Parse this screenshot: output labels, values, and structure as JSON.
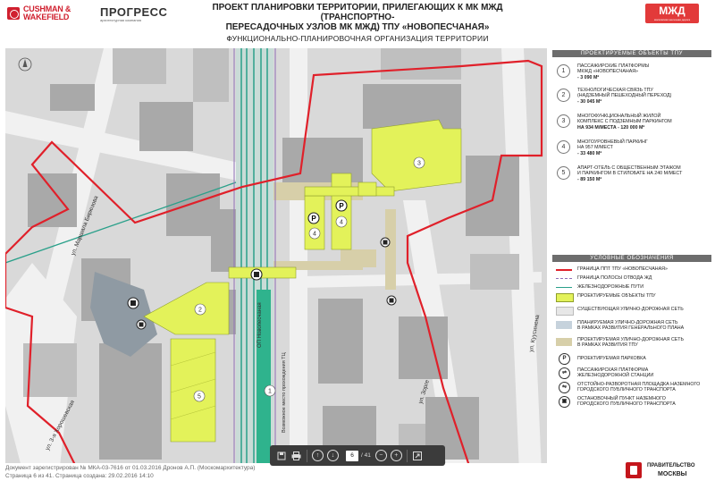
{
  "header": {
    "cw_brand_line1": "CUSHMAN &",
    "cw_brand_line2": "WAKEFIELD",
    "pr_brand": "ПРОГРЕСС",
    "pr_sub": "архитектурная компания",
    "title_line1": "ПРОЕКТ ПЛАНИРОВКИ ТЕРРИТОРИИ, ПРИЛЕГАЮЩИХ К МК МЖД  (ТРАНСПОРТНО-",
    "title_line2": "ПЕРЕСАДОЧНЫХ УЗЛОВ МК МЖД) ТПУ «НОВОПЕСЧАНАЯ»",
    "subtitle": "ФУНКЦИОНАЛЬНО-ПЛАНИРОВОЧНАЯ ОРГАНИЗАЦИЯ ТЕРРИТОРИИ",
    "mzd_brand": "МЖД",
    "mzd_sub": "московская железная дорога"
  },
  "map": {
    "street_labels": [
      "ул. Маршала Бирюзова",
      "ОП Новопесчаная",
      "Возможное место прохождения ТЦ",
      "ул. Зорге",
      "ул. Куусинена",
      "ул. 3-я Хорошевская"
    ],
    "object_markers": [
      "1",
      "2",
      "3",
      "4",
      "4",
      "5"
    ],
    "parking_symbol": "P"
  },
  "panel": {
    "objects_header": "ПРОЕКТИРУЕМЫЕ ОБЪЕКТЫ ТПУ",
    "objects": [
      {
        "num": "1",
        "lines": [
          "ПАССАЖИРСКИЕ ПЛАТФОРМЫ",
          "МКЖД «НОВОПЕСЧАНАЯ»",
          "- 3 090 М²"
        ]
      },
      {
        "num": "2",
        "lines": [
          "ТЕХНОЛОГИЧЕСКАЯ СВЯЗЬ ТПУ",
          "(НАДЗЕМНЫЙ ПЕШЕХОДНЫЙ ПЕРЕХОД)",
          "- 30 045 М²"
        ]
      },
      {
        "num": "3",
        "lines": [
          "МНОГОФУНКЦИОНАЛЬНЫЙ ЖИЛОЙ",
          "КОМПЛЕКС С ПОДЗЕМНЫМ ПАРКИНГОМ",
          "НА 934 М/МЕСТА - 120 000 М²"
        ]
      },
      {
        "num": "4",
        "lines": [
          "МНОГОУРОВНЕВЫЙ ПАРКИНГ",
          "НА 957 М/МЕСТ",
          "- 33 480 М²"
        ]
      },
      {
        "num": "5",
        "lines": [
          "АПАРТ-ОТЕЛЬ С ОБЩЕСТВЕННЫМ ЭТАЖОМ",
          "И ПАРКИНГОМ В СТИЛОБАТЕ НА 240 М/МЕСТ",
          "- 89 150 М²"
        ]
      }
    ],
    "legend_header": "УСЛОВНЫЕ ОБОЗНАЧЕНИЯ",
    "legend": [
      {
        "key": "boundary",
        "lines": [
          "ГРАНИЦА ППТ ТПУ «НОВОПЕСЧАНАЯ»"
        ]
      },
      {
        "key": "rail_strip",
        "lines": [
          "ГРАНИЦА ПОЛОСЫ ОТВОДА ЖД"
        ]
      },
      {
        "key": "rail",
        "lines": [
          "ЖЕЛЕЗНОДОРОЖНЫЕ ПУТИ"
        ]
      },
      {
        "key": "tpu",
        "lines": [
          "ПРОЕКТИРУЕМЫЕ ОБЪЕКТЫ ТПУ"
        ]
      },
      {
        "key": "existing_road",
        "lines": [
          "СУЩЕСТВУЮЩАЯ УЛИЧНО-ДОРОЖНАЯ СЕТЬ"
        ]
      },
      {
        "key": "planned_road",
        "lines": [
          "ПЛАНИРУЕМАЯ УЛИЧНО-ДОРОЖНАЯ СЕТЬ",
          "В РАМКАХ РАЗВИТИЯ ГЕНЕРАЛЬНОГО ПЛАНА"
        ]
      },
      {
        "key": "designed_road",
        "lines": [
          "ПРОЕКТИРУЕМАЯ УЛИЧНО-ДОРОЖНАЯ СЕТЬ",
          "В РАМКАХ РАЗВИТИЯ ТПУ"
        ]
      },
      {
        "key": "parking",
        "sym": "P",
        "lines": [
          "ПРОЕКТИРУЕМАЯ ПАРКОВКА"
        ]
      },
      {
        "key": "platform",
        "sym": "⇌",
        "lines": [
          "ПАССАЖИРСКАЯ ПЛАТФОРМА",
          "ЖЕЛЕЗНОДОРОЖНОЙ СТАНЦИИ"
        ]
      },
      {
        "key": "turnaround",
        "sym": "⇋",
        "lines": [
          "ОТСТОЙНО-РАЗВОРОТНАЯ ПЛОЩАДКА НАЗЕМНОГО",
          "ГОРОДСКОГО ПУБЛИЧНОГО ТРАНСПОРТА"
        ]
      },
      {
        "key": "stop",
        "sym": "▣",
        "lines": [
          "ОСТАНОВОЧНЫЙ ПУНКТ НАЗЕМНОГО",
          "ГОРОДСКОГО ПУБЛИЧНОГО ТРАНСПОРТА"
        ]
      }
    ],
    "colors": {
      "boundary": "#e0202a",
      "rail_strip": "#8e6fb8",
      "rail": "#2aa08a",
      "tpu": "#e3f25a",
      "existing_road": "#e7e7e7",
      "planned_road": "#c6d2dc",
      "designed_road": "#d7cfa9"
    }
  },
  "footer": {
    "line1": "Документ зарегистрирован № МКА-03-7616 от 01.03.2016 Дронов А.П. (Москомархитектура)",
    "line2": "Страница 6 из 41. Страница создана: 29.02.2016 14:10"
  },
  "moscow": {
    "line1": "ПРАВИТЕЛЬСТВО",
    "line2": "МОСКВЫ"
  },
  "toolbar": {
    "page_current": "6",
    "page_total": "/ 41"
  }
}
